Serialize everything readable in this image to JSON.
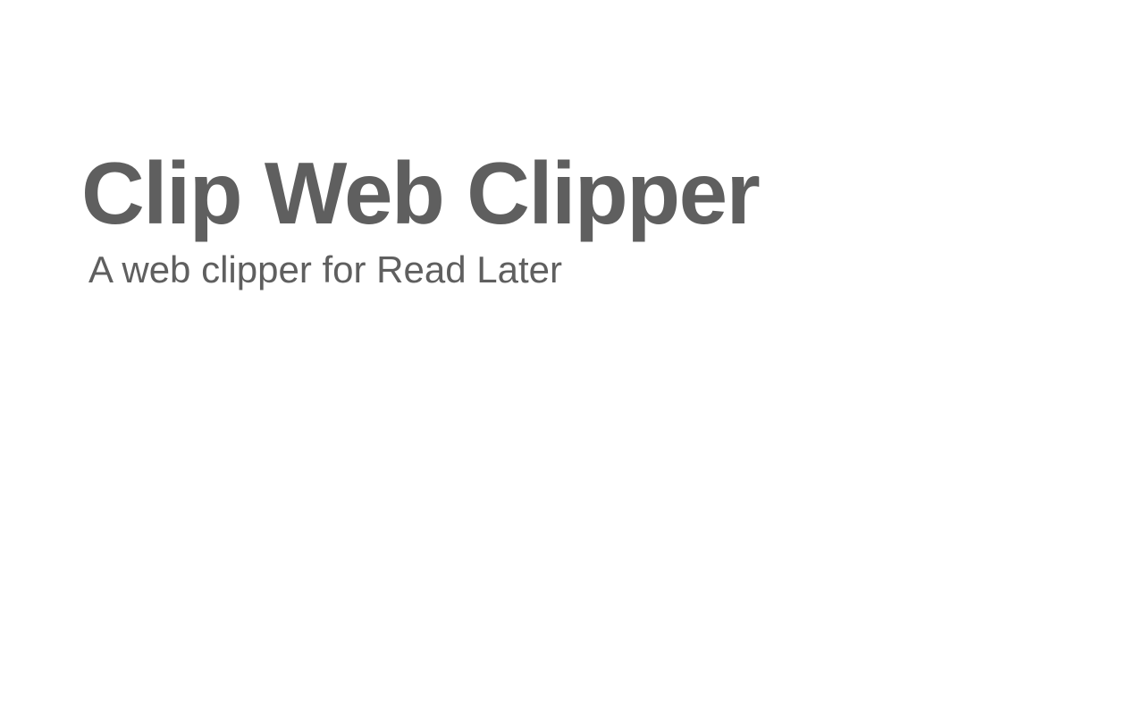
{
  "hero": {
    "title": "Clip Web Clipper",
    "subtitle": "A web clipper for Read Later"
  },
  "colors": {
    "background": "#ffffff",
    "text": "#5f5f5f"
  }
}
